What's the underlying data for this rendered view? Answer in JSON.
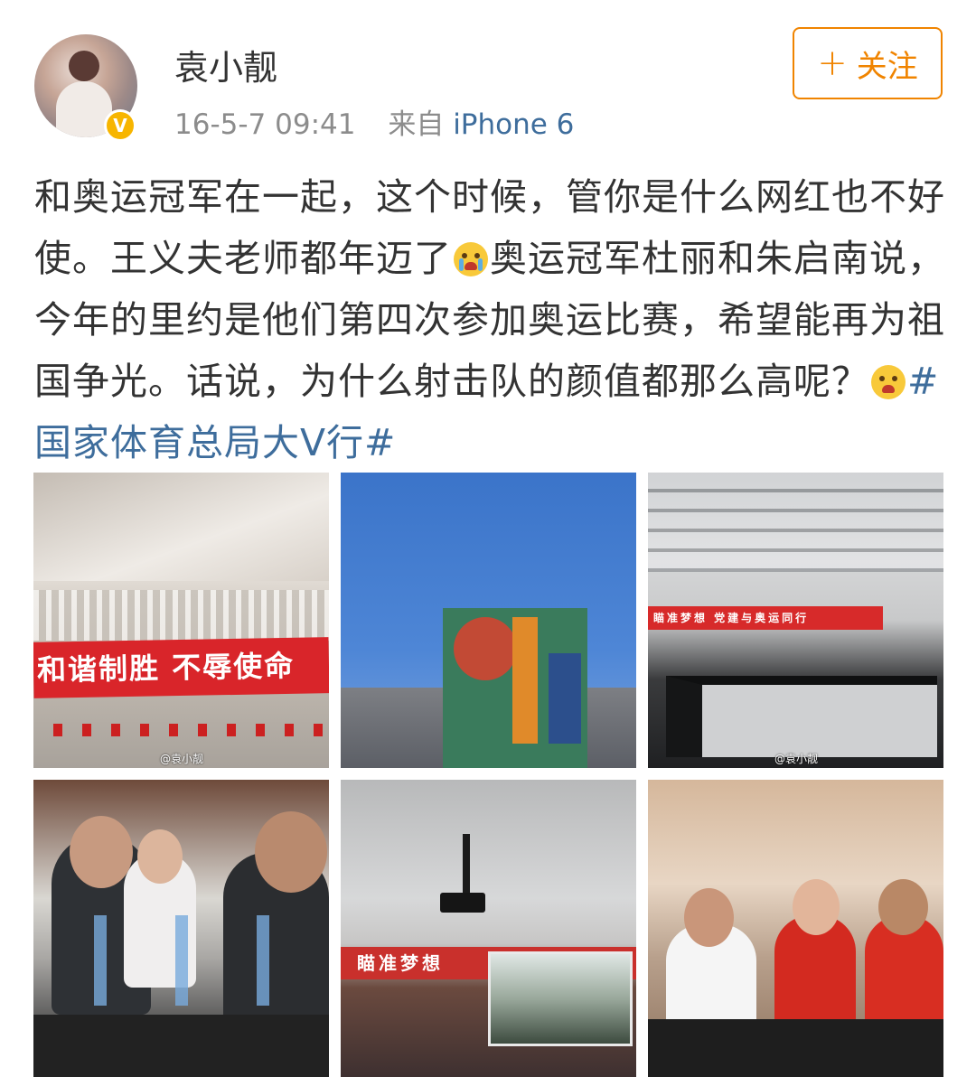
{
  "post": {
    "username": "袁小靓",
    "timestamp": "16-5-7 09:41",
    "source_prefix": "来自",
    "source_name": "iPhone 6",
    "follow_button": {
      "icon": "plus-icon",
      "label": "关注"
    },
    "content": {
      "part1": "和奥运冠军在一起，这个时候，管你是什么网红也不好使。王义夫老师都年迈了",
      "emoji1": "crying-face-icon",
      "part2": "奥运冠军杜丽和朱启南说，今年的里约是他们第四次参加奥运比赛，希望能再为祖国争光。话说，为什么射击队的颜值都那么高呢？",
      "emoji2": "screaming-face-icon",
      "hashtag": "#国家体育总局大V行#"
    },
    "verified_badge": "V",
    "images": [
      {
        "name": "photo-red-banner",
        "banner_text": "和谐制胜  不辱使命",
        "watermark": "@袁小靓"
      },
      {
        "name": "photo-building-sky"
      },
      {
        "name": "photo-meeting-room",
        "banner_text": "瞄准梦想 党建与奥运同行",
        "watermark": "@袁小靓"
      },
      {
        "name": "photo-officials"
      },
      {
        "name": "photo-projector",
        "banner_text": "瞄准梦想"
      },
      {
        "name": "photo-athletes"
      }
    ]
  },
  "colors": {
    "accent_orange": "#f08400",
    "link_blue": "#3e6d9c",
    "verified_yellow": "#f7b500",
    "text": "#333333",
    "meta_gray": "#8c8c8c"
  }
}
